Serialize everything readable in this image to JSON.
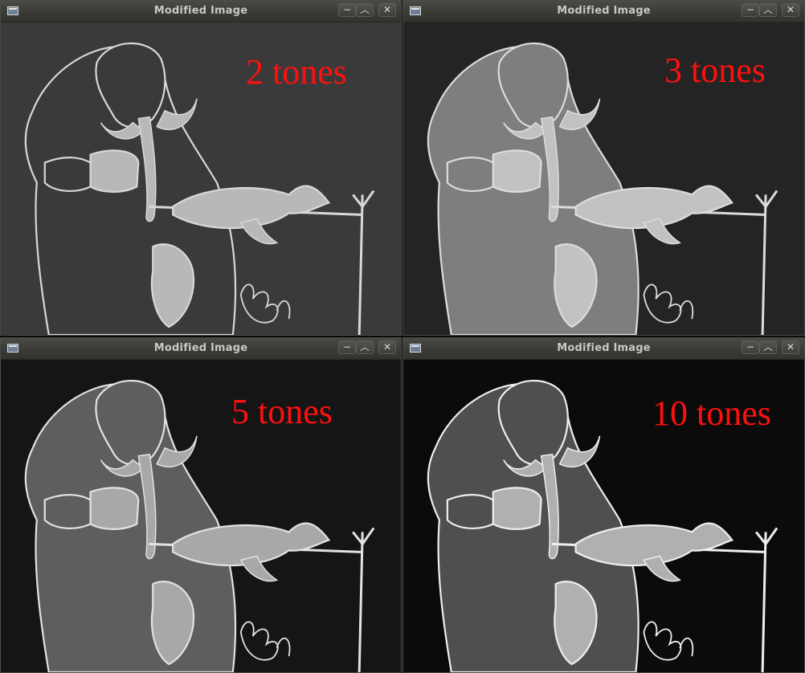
{
  "windows": [
    {
      "title": "Modified Image",
      "tone_label": "2 tones",
      "icons": {
        "app": "window-icon",
        "minimize": "minimize-icon",
        "maximize": "maximize-icon",
        "close": "close-icon"
      },
      "colors": {
        "background": "#3a3a3a",
        "figure": "#3a3a3a",
        "light": "#b8b8b8",
        "outline": "#d8d8d8"
      }
    },
    {
      "title": "Modified Image",
      "tone_label": "3 tones",
      "icons": {
        "app": "window-icon",
        "minimize": "minimize-icon",
        "maximize": "maximize-icon",
        "close": "close-icon"
      },
      "colors": {
        "background": "#242424",
        "figure": "#7e7e7e",
        "light": "#c2c2c2",
        "outline": "#dcdcdc"
      }
    },
    {
      "title": "Modified Image",
      "tone_label": "5 tones",
      "icons": {
        "app": "window-icon",
        "minimize": "minimize-icon",
        "maximize": "maximize-icon",
        "close": "close-icon"
      },
      "colors": {
        "background": "#151515",
        "figure": "#5e5e5e",
        "light": "#a8a8a8",
        "outline": "#e2e2e2"
      }
    },
    {
      "title": "Modified Image",
      "tone_label": "10 tones",
      "icons": {
        "app": "window-icon",
        "minimize": "minimize-icon",
        "maximize": "maximize-icon",
        "close": "close-icon"
      },
      "colors": {
        "background": "#0b0b0b",
        "figure": "#4f4f4f",
        "light": "#b0b0b0",
        "outline": "#eeeeee"
      }
    }
  ],
  "label_color": "#ff1010",
  "window_buttons": {
    "minimize": "−",
    "maximize": "︿",
    "close": "✕"
  }
}
